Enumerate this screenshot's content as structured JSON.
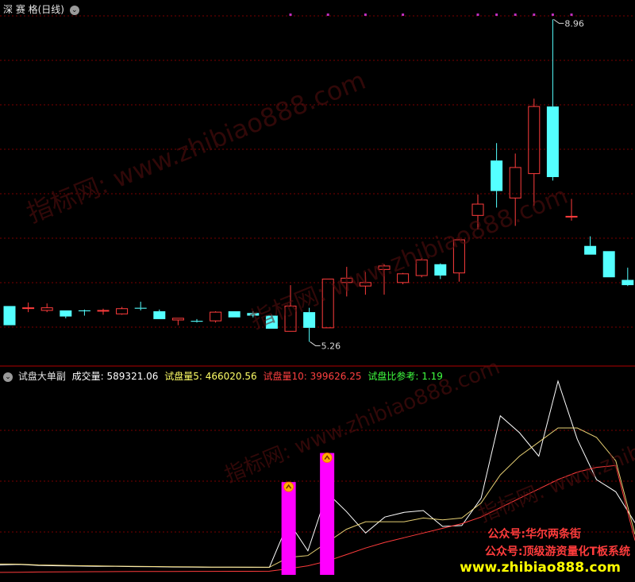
{
  "top_panel": {
    "title": "深 赛 格(日线)",
    "high_label": "8.96",
    "low_label": "5.26"
  },
  "bottom_panel": {
    "indicator_name": "试盘大单副",
    "vol_label": "成交量: 589321.06",
    "ma5_label": "试盘量5: 466020.56",
    "ma10_label": "试盘量10: 399626.25",
    "ratio_label": "试盘比参考: 1.19"
  },
  "watermarks": [
    "指标网: www.zhibiao888.com",
    "指标网: www.zhibiao888.com",
    "指标网: www.zhibiao888.com",
    "指标网: www.zhibiao888.com"
  ],
  "promo": {
    "line1": "公众号:华尔两条街",
    "line2": "公众号:顶级游资量化T板系统",
    "line3": "www.zhibiao888.com"
  },
  "colors": {
    "up": "#ff3c3c",
    "down": "#54ffff",
    "grid": "#7a0000",
    "signal": "#ff00ff",
    "dots": "#c030c0",
    "ma10": "#ff3c3c",
    "vol": "#ffffff"
  },
  "chart_data": [
    {
      "type": "candlestick",
      "title": "深 赛 格(日线)",
      "ylim": [
        5.1,
        9.0
      ],
      "candles": [
        {
          "o": 5.67,
          "h": 5.67,
          "l": 5.45,
          "c": 5.45
        },
        {
          "o": 5.65,
          "h": 5.71,
          "l": 5.6,
          "c": 5.65
        },
        {
          "o": 5.62,
          "h": 5.7,
          "l": 5.6,
          "c": 5.65
        },
        {
          "o": 5.62,
          "h": 5.62,
          "l": 5.53,
          "c": 5.55
        },
        {
          "o": 5.62,
          "h": 5.63,
          "l": 5.56,
          "c": 5.61
        },
        {
          "o": 5.62,
          "h": 5.64,
          "l": 5.57,
          "c": 5.62
        },
        {
          "o": 5.58,
          "h": 5.66,
          "l": 5.57,
          "c": 5.64
        },
        {
          "o": 5.65,
          "h": 5.72,
          "l": 5.62,
          "c": 5.64
        },
        {
          "o": 5.61,
          "h": 5.63,
          "l": 5.52,
          "c": 5.52
        },
        {
          "o": 5.51,
          "h": 5.53,
          "l": 5.45,
          "c": 5.53
        },
        {
          "o": 5.5,
          "h": 5.52,
          "l": 5.48,
          "c": 5.49
        },
        {
          "o": 5.5,
          "h": 5.61,
          "l": 5.48,
          "c": 5.6
        },
        {
          "o": 5.61,
          "h": 5.61,
          "l": 5.54,
          "c": 5.54
        },
        {
          "o": 5.59,
          "h": 5.61,
          "l": 5.54,
          "c": 5.56
        },
        {
          "o": 5.56,
          "h": 5.57,
          "l": 5.41,
          "c": 5.41
        },
        {
          "o": 5.38,
          "h": 5.91,
          "l": 5.38,
          "c": 5.67
        },
        {
          "o": 5.6,
          "h": 5.65,
          "l": 5.26,
          "c": 5.42
        },
        {
          "o": 5.42,
          "h": 5.98,
          "l": 5.42,
          "c": 5.98
        },
        {
          "o": 5.94,
          "h": 6.12,
          "l": 5.78,
          "c": 5.99
        },
        {
          "o": 5.9,
          "h": 6.06,
          "l": 5.8,
          "c": 5.94
        },
        {
          "o": 6.09,
          "h": 6.15,
          "l": 5.8,
          "c": 6.13
        },
        {
          "o": 5.94,
          "h": 6.05,
          "l": 5.92,
          "c": 6.04
        },
        {
          "o": 6.02,
          "h": 6.22,
          "l": 6.0,
          "c": 6.2
        },
        {
          "o": 6.15,
          "h": 6.16,
          "l": 5.98,
          "c": 6.02
        },
        {
          "o": 6.05,
          "h": 6.44,
          "l": 5.95,
          "c": 6.43
        },
        {
          "o": 6.71,
          "h": 6.95,
          "l": 6.55,
          "c": 6.84
        },
        {
          "o": 7.34,
          "h": 7.54,
          "l": 6.8,
          "c": 6.99
        },
        {
          "o": 6.91,
          "h": 7.42,
          "l": 6.59,
          "c": 7.26
        },
        {
          "o": 7.19,
          "h": 8.05,
          "l": 6.82,
          "c": 7.96
        },
        {
          "o": 7.96,
          "h": 8.96,
          "l": 7.11,
          "c": 7.15
        },
        {
          "o": 6.7,
          "h": 6.9,
          "l": 6.65,
          "c": 6.7
        },
        {
          "o": 6.36,
          "h": 6.47,
          "l": 6.26,
          "c": 6.26
        },
        {
          "o": 6.3,
          "h": 6.3,
          "l": 6.0,
          "c": 6.0
        },
        {
          "o": 5.97,
          "h": 6.11,
          "l": 5.9,
          "c": 5.91
        }
      ],
      "annotations": [
        {
          "text": "8.96",
          "value": 8.96,
          "index": 29
        },
        {
          "text": "5.26",
          "value": 5.26,
          "index": 16
        }
      ],
      "signal_dot_indices": [
        15,
        17,
        19,
        21,
        25,
        26,
        27,
        28,
        29,
        30
      ]
    },
    {
      "type": "line",
      "title": "试盘大单副",
      "ylim": [
        0,
        2100000
      ],
      "series": [
        {
          "name": "成交量",
          "values": [
            140000,
            145000,
            135000,
            130000,
            128000,
            125000,
            125000,
            122000,
            120000,
            118000,
            116000,
            115000,
            115000,
            114000,
            114000,
            600000,
            290000,
            910000,
            710000,
            480000,
            650000,
            700000,
            720000,
            550000,
            560000,
            850000,
            1730000,
            1550000,
            1300000,
            2100000,
            1480000,
            1050000,
            920000,
            589321
          ]
        },
        {
          "name": "试盘量5",
          "values": [
            150000,
            148000,
            140000,
            136000,
            132000,
            130000,
            127000,
            125000,
            123000,
            121000,
            119000,
            117000,
            116000,
            116000,
            115000,
            220000,
            240000,
            380000,
            520000,
            600000,
            600000,
            600000,
            640000,
            620000,
            640000,
            800000,
            1100000,
            1300000,
            1450000,
            1600000,
            1600000,
            1500000,
            1250000,
            466021
          ]
        },
        {
          "name": "试盘量10",
          "values": [
            60000,
            62000,
            64000,
            66000,
            67000,
            68000,
            69000,
            70000,
            70000,
            70000,
            71000,
            71000,
            72000,
            72000,
            73000,
            100000,
            130000,
            180000,
            250000,
            320000,
            380000,
            430000,
            480000,
            530000,
            580000,
            650000,
            750000,
            850000,
            950000,
            1050000,
            1130000,
            1180000,
            1200000,
            399626
          ]
        }
      ],
      "signal_bars": [
        {
          "index": 15,
          "value": 600000
        },
        {
          "index": 17,
          "value": 910000
        }
      ]
    }
  ]
}
